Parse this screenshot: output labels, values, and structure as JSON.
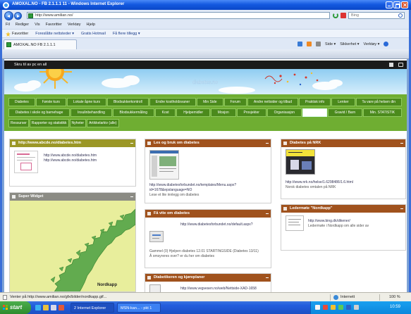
{
  "window": {
    "title": "AMOXAL.NO - FB 2.1.1.1 11 - Windows Internet Explorer"
  },
  "address": {
    "url": "http://www.amilian.no/",
    "search_placeholder": "Bing"
  },
  "menu": [
    "Fil",
    "Rediger",
    "Vis",
    "Favoritter",
    "Verktøy",
    "Hjelp"
  ],
  "favorites": {
    "label": "Favoritter",
    "items": [
      "Foreslåtte nettsteder ▾",
      "Gratis Hotmail",
      "Få flere tillegg ▾"
    ]
  },
  "tab": {
    "label": "AMOXAL.NO FB 2.1.1.1"
  },
  "command_bar": {
    "page": "Side ▾",
    "safety": "Sikkerhet ▾",
    "tools": "Verktøy ▾"
  },
  "site_bar": {
    "text": "Skru til av pc en all"
  },
  "header": {
    "title": "diabetes.no"
  },
  "nav": {
    "rows": [
      [
        {
          "label": "Diabetes"
        },
        {
          "label": "Første kurs"
        },
        {
          "label": "Lokale åpne kurs"
        },
        {
          "label": "Blodsukkerkontroll"
        },
        {
          "label": "Endre kostholdsvaner"
        },
        {
          "label": "Min Side"
        },
        {
          "label": "Forum"
        },
        {
          "label": "Andre nettsider og tilbud"
        },
        {
          "label": "Praktisk info"
        },
        {
          "label": "Lenker"
        },
        {
          "label": "Ta vare på helsen din"
        }
      ],
      [
        {
          "label": "Diabetes i skole og barnehage"
        },
        {
          "label": "Insulinbehandling"
        },
        {
          "label": "Blodsukkermåling"
        },
        {
          "label": "Kost"
        },
        {
          "label": "Hjelpemidler"
        },
        {
          "label": "Mosjon"
        },
        {
          "label": "Prosjekter"
        },
        {
          "label": "Organisasjon"
        },
        {
          "label": "",
          "active": true
        },
        {
          "label": "Gravid / Barn"
        },
        {
          "label": "Min. STATISTIK"
        }
      ],
      [
        {
          "label": "Ressurser"
        },
        {
          "label": "Rapporter og statistikk"
        },
        {
          "label": "Nyheter"
        },
        {
          "label": "Artikkelarkiv (alle)"
        }
      ]
    ]
  },
  "panels": {
    "c1p1": {
      "title": "http://www.abcde.no/diabetes.htm",
      "lines": [
        "http://www.abcde.no/diabetes.htm",
        "http://www.abcde.no/diabetes.htm"
      ]
    },
    "c1p2": {
      "title": "Super Widget",
      "map_label": "Nordkapp"
    },
    "c2p1": {
      "title": "Les og bruk om diabetes",
      "lines": [
        "http://www.diabetesforbundet.no/templates/Menu.aspx?",
        "id=1678&epslanguage=NO",
        "Lese et lite innlegg om diabetes"
      ]
    },
    "c2p2": {
      "title": "Få vite om diabetes",
      "url": "http://www.diabetesforbundet.no/default.aspx?",
      "lines": [
        "Gammel (0) Hjelpen diabetes 12.01 STARTINGSIDE (Diabetes 13/11)",
        "Å omsyreres over? er du her om diabetes"
      ]
    },
    "c2p3": {
      "title": "Diabetikeren og kjøreplaner",
      "lines": [
        "http://www.vegvesen.no/web/Nettside-XAD-1658"
      ]
    },
    "c3p1": {
      "title": "Diabetes på NRK",
      "lines": [
        "http://www.nrk.no/helse/1.6298486/1.6.html",
        "Norsk diabetes omtalen på NRK"
      ]
    },
    "c3p2": {
      "title": "Ledermøte \"Nordkapp\"",
      "lines": [
        "http://www.bing.dk/dikener/",
        "Ledermøte i Nordkapp om alle sider av"
      ]
    }
  },
  "status": {
    "text": "Venter på http://www.amilian.no/gfx/bilder/nordkapp.gif...",
    "zone": "Internett",
    "zoom": "100 %"
  },
  "taskbar": {
    "start": "start",
    "tasks": [
      "2 Internet Explorer",
      "MSN-kan... - pkt 1"
    ],
    "time": "10:59"
  },
  "colors": {
    "title_bar": "#1459e0",
    "nav_green": "#4b8a1c",
    "panel_olive": "#9b9726",
    "panel_grey": "#8b8b84",
    "panel_brown": "#a0521d",
    "map_land": "#62ab4f",
    "map_sea": "#e8ee9c"
  },
  "icons": [
    "ie-icon",
    "back-icon",
    "forward-icon",
    "refresh-icon",
    "stop-icon",
    "search-icon",
    "favorites-star-icon",
    "home-icon",
    "feed-icon",
    "print-icon",
    "help-icon",
    "globe-icon",
    "windows-flag-icon"
  ]
}
